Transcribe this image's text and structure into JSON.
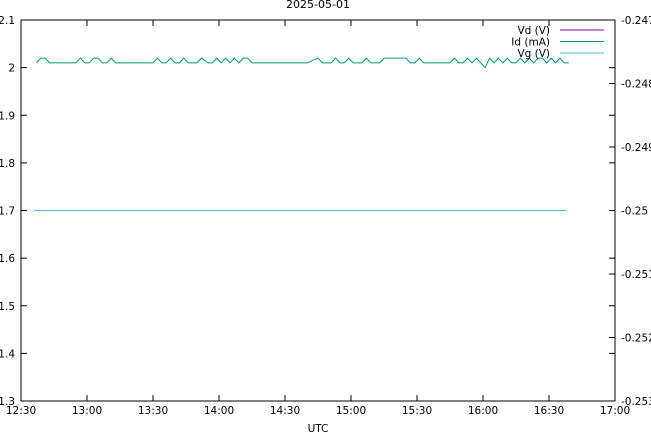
{
  "chart_data": {
    "type": "line",
    "title": "2025-05-01",
    "xlabel": "UTC",
    "ylabel": "",
    "y2label": "",
    "x_ticks": [
      "12:30",
      "13:00",
      "13:30",
      "14:00",
      "14:30",
      "15:00",
      "15:30",
      "16:00",
      "16:30",
      "17:00"
    ],
    "xlim_minutes": [
      750,
      1020
    ],
    "ylim": [
      1.3,
      2.1
    ],
    "y_ticks": [
      "1.3",
      "1.4",
      "1.5",
      "1.6",
      "1.7",
      "1.8",
      "1.9",
      "2",
      "2.1"
    ],
    "y2lim": [
      -0.253,
      -0.247
    ],
    "y2_ticks": [
      "-0.253",
      "-0.252",
      "-0.251",
      "-0.25",
      "-0.249",
      "-0.248",
      "-0.247"
    ],
    "legend_position": "top-right",
    "series": [
      {
        "name": "Vd (V)",
        "axis": "left",
        "color": "#94009f",
        "times": [],
        "values": []
      },
      {
        "name": "Id (mA)",
        "axis": "left",
        "color": "#009e73",
        "times": [
          "12:37",
          "12:39",
          "12:41",
          "12:43",
          "12:45",
          "12:50",
          "12:55",
          "12:57",
          "12:59",
          "13:01",
          "13:03",
          "13:05",
          "13:07",
          "13:09",
          "13:11",
          "13:13",
          "13:15",
          "13:20",
          "13:25",
          "13:30",
          "13:32",
          "13:34",
          "13:36",
          "13:38",
          "13:40",
          "13:42",
          "13:44",
          "13:46",
          "13:48",
          "13:50",
          "13:52",
          "13:55",
          "13:57",
          "13:59",
          "14:01",
          "14:03",
          "14:05",
          "14:07",
          "14:09",
          "14:11",
          "14:13",
          "14:15",
          "14:20",
          "14:25",
          "14:30",
          "14:35",
          "14:40",
          "14:45",
          "14:47",
          "14:49",
          "14:51",
          "14:53",
          "14:55",
          "14:57",
          "14:59",
          "15:01",
          "15:03",
          "15:05",
          "15:07",
          "15:09",
          "15:11",
          "15:13",
          "15:15",
          "15:20",
          "15:25",
          "15:27",
          "15:29",
          "15:31",
          "15:33",
          "15:35",
          "15:37",
          "15:40",
          "15:45",
          "15:47",
          "15:49",
          "15:51",
          "15:53",
          "15:55",
          "15:57",
          "15:59",
          "16:01",
          "16:03",
          "16:05",
          "16:07",
          "16:09",
          "16:11",
          "16:13",
          "16:15",
          "16:17",
          "16:19",
          "16:21",
          "16:23",
          "16:25",
          "16:27",
          "16:29",
          "16:31",
          "16:33",
          "16:35",
          "16:37",
          "16:39"
        ],
        "values": [
          2.01,
          2.02,
          2.02,
          2.01,
          2.01,
          2.01,
          2.01,
          2.02,
          2.01,
          2.01,
          2.02,
          2.02,
          2.01,
          2.01,
          2.02,
          2.01,
          2.01,
          2.01,
          2.01,
          2.01,
          2.02,
          2.01,
          2.01,
          2.02,
          2.01,
          2.01,
          2.02,
          2.01,
          2.01,
          2.01,
          2.02,
          2.01,
          2.01,
          2.02,
          2.01,
          2.02,
          2.01,
          2.02,
          2.01,
          2.02,
          2.02,
          2.01,
          2.01,
          2.01,
          2.01,
          2.01,
          2.01,
          2.02,
          2.01,
          2.01,
          2.01,
          2.02,
          2.01,
          2.01,
          2.02,
          2.01,
          2.01,
          2.01,
          2.02,
          2.01,
          2.01,
          2.01,
          2.02,
          2.02,
          2.02,
          2.01,
          2.01,
          2.02,
          2.01,
          2.01,
          2.01,
          2.01,
          2.01,
          2.02,
          2.01,
          2.01,
          2.02,
          2.01,
          2.02,
          2.01,
          2.0,
          2.02,
          2.01,
          2.02,
          2.01,
          2.02,
          2.01,
          2.01,
          2.02,
          2.01,
          2.02,
          2.01,
          2.02,
          2.02,
          2.01,
          2.02,
          2.01,
          2.02,
          2.01,
          2.01
        ]
      },
      {
        "name": "Vg (V)",
        "axis": "right",
        "color": "#56b4e9",
        "times": [
          "12:36",
          "16:38"
        ],
        "values": [
          -0.25,
          -0.25
        ]
      }
    ]
  }
}
